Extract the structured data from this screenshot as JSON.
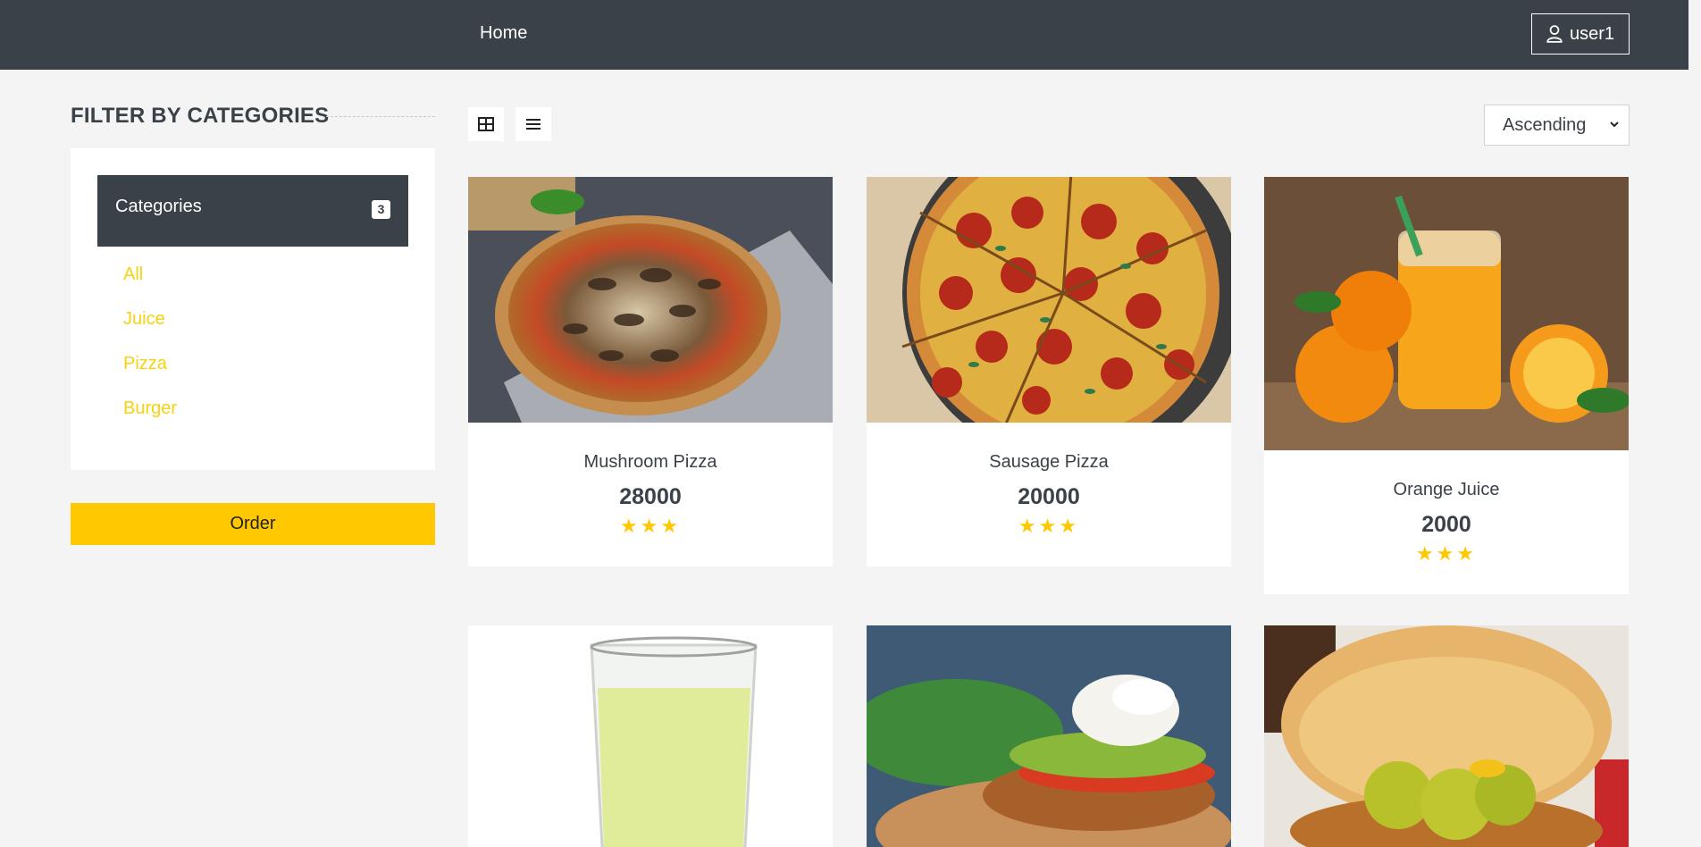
{
  "navbar": {
    "home_label": "Home",
    "user_label": "user1"
  },
  "sidebar": {
    "title": "FILTER BY CATEGORIES",
    "categories_header": "Categories",
    "categories_count": "3",
    "items": [
      {
        "label": "All"
      },
      {
        "label": "Juice"
      },
      {
        "label": "Pizza"
      },
      {
        "label": "Burger"
      }
    ],
    "order_label": "Order"
  },
  "toolbar": {
    "sort_value": "Ascending"
  },
  "products": [
    {
      "name": "Mushroom Pizza",
      "price": "28000",
      "rating": 3,
      "stars": "★★★"
    },
    {
      "name": "Sausage Pizza",
      "price": "20000",
      "rating": 3,
      "stars": "★★★"
    },
    {
      "name": "Orange Juice",
      "price": "2000",
      "rating": 3,
      "stars": "★★★"
    },
    {
      "name": "",
      "price": "",
      "rating": null,
      "stars": ""
    },
    {
      "name": "",
      "price": "",
      "rating": null,
      "stars": ""
    },
    {
      "name": "",
      "price": "",
      "rating": null,
      "stars": ""
    }
  ],
  "colors": {
    "navbar": "#3b4149",
    "accent": "#ffc800",
    "category_link": "#f7d20e",
    "background": "#f4f4f4"
  }
}
